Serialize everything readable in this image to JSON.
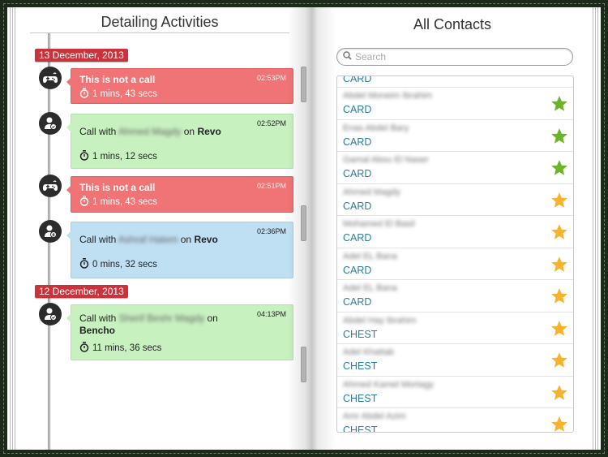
{
  "left_page": {
    "title": "Detailing Activities",
    "groups": [
      {
        "date": "13 December, 2013",
        "items": [
          {
            "type": "not-call",
            "color": "red",
            "icon": "gamepad-icon",
            "title": "This is not a call",
            "time": "02:53PM",
            "duration": "1 mins, 43 secs"
          },
          {
            "type": "call",
            "color": "green",
            "icon": "user-check-icon",
            "prefix": "Call with",
            "contact": "Ahmed Magdy",
            "on": "on",
            "product": "Revo",
            "time": "02:52PM",
            "duration": "1 mins, 12 secs"
          },
          {
            "type": "not-call",
            "color": "red",
            "icon": "gamepad-icon",
            "title": "This is not a call",
            "time": "02:51PM",
            "duration": "1 mins, 43 secs"
          },
          {
            "type": "call",
            "color": "blue",
            "icon": "user-pending-icon",
            "prefix": "Call with",
            "contact": "Ashraf Hatem",
            "on": "on",
            "product": "Revo",
            "time": "02:36PM",
            "duration": "0 mins, 32 secs"
          }
        ]
      },
      {
        "date": "12 December, 2013",
        "items": [
          {
            "type": "call",
            "color": "green",
            "icon": "user-check-icon",
            "prefix": "Call with",
            "contact": "Sherif Beshr Magdy",
            "on": "on",
            "product": "Bencho",
            "time": "04:13PM",
            "duration": "11 mins, 36 secs"
          }
        ]
      }
    ]
  },
  "right_page": {
    "title": "All Contacts",
    "search": {
      "placeholder": "Search",
      "value": ""
    },
    "partial_top_category": "CARD",
    "contacts": [
      {
        "name": "Abdel Moneim Ibrahim",
        "category": "CARD",
        "star": "green"
      },
      {
        "name": "Enas Abdel Bary",
        "category": "CARD",
        "star": "green"
      },
      {
        "name": "Gamal Abou El Naser",
        "category": "CARD",
        "star": "green"
      },
      {
        "name": "Ahmed Magdy",
        "category": "CARD",
        "star": "orange"
      },
      {
        "name": "Mohamed El Basil",
        "category": "CARD",
        "star": "orange"
      },
      {
        "name": "Adel EL Bana",
        "category": "CARD",
        "star": "orange"
      },
      {
        "name": "Adel EL Bana",
        "category": "CARD",
        "star": "orange"
      },
      {
        "name": "Abdel Hay Ibrahim",
        "category": "CHEST",
        "star": "orange"
      },
      {
        "name": "Adel Khattab",
        "category": "CHEST",
        "star": "orange"
      },
      {
        "name": "Ahmed Kamel Mortagy",
        "category": "CHEST",
        "star": "orange"
      },
      {
        "name": "Amr Abdel Azim",
        "category": "CHEST",
        "star": "orange"
      }
    ]
  },
  "colors": {
    "date_badge": "#c9343c",
    "card_red": "#f07375",
    "card_green": "#c7f1bf",
    "card_blue": "#bfdff3",
    "category_text": "#2a7da0",
    "star_green": "#6cb52a",
    "star_orange": "#f7b32b"
  }
}
